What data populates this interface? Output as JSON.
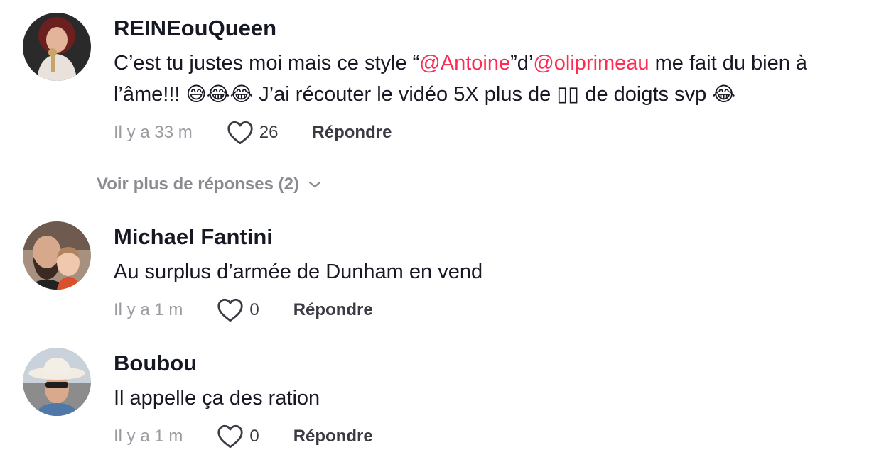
{
  "comments": [
    {
      "username": "REINEouQueen",
      "text_part1": "C’est tu justes moi mais ce style “",
      "mention1": "@Antoine",
      "text_part2": "”d’",
      "mention2": "@oliprimeau",
      "text_part3": " me fait du bien à l’âme!!! ",
      "emojis1": "😅😂😂",
      "text_part4": " J’ai récouter le vidéo 5X plus de ",
      "boxes": "▯▯",
      "text_part5": " de doigts svp ",
      "emojis2": "😂",
      "time": "Il y a 33 m",
      "likes": "26",
      "reply_label": "Répondre",
      "avatar_icon": "woman-with-microphone-avatar"
    },
    {
      "username": "Michael Fantini",
      "text": "Au surplus d’armée de Dunham en vend",
      "time": "Il y a 1 m",
      "likes": "0",
      "reply_label": "Répondre",
      "avatar_icon": "man-and-child-avatar"
    },
    {
      "username": "Boubou",
      "text": "Il appelle ça des ration",
      "time": "Il y a 1 m",
      "likes": "0",
      "reply_label": "Répondre",
      "avatar_icon": "man-with-cowboy-hat-avatar"
    }
  ],
  "view_more_label": "Voir plus de réponses (2)",
  "colors": {
    "mention": "#fe2c55",
    "text": "#161823",
    "muted": "#9a9aa0"
  }
}
